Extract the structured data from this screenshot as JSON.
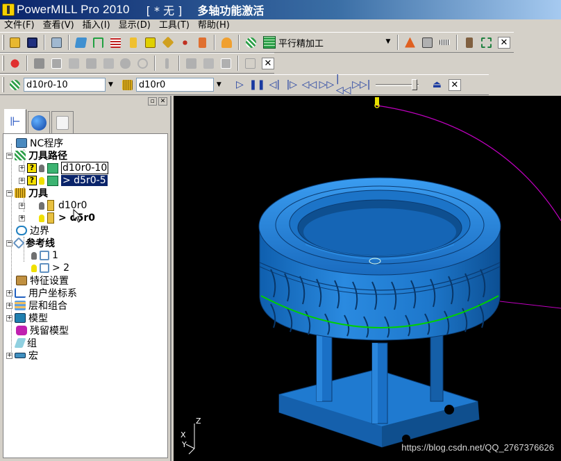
{
  "window": {
    "app_title": "PowerMILL Pro 2010",
    "project": "[ * 无 ]",
    "name": "多轴功能激活"
  },
  "menu": [
    "文件(F)",
    "查看(V)",
    "插入(I)",
    "显示(D)",
    "工具(T)",
    "帮助(H)"
  ],
  "toolbar_main": {
    "strategy_combo": "平行精加工"
  },
  "toolbar_selectors": {
    "toolpath_combo": "d10r0-10",
    "tool_combo": "d10r0"
  },
  "explorer": {
    "items": {
      "nc_programs": "NC程序",
      "toolpaths": "刀具路径",
      "toolpath_1": "d10r0-10",
      "toolpath_2": "> d5r0-5",
      "tools": "刀具",
      "tool_1": "d10r0",
      "tool_2": "> d5r0",
      "boundaries": "边界",
      "patterns": "参考线",
      "pattern_1": "1",
      "pattern_2": "> 2",
      "feature_sets": "特征设置",
      "workplanes": "用户坐标系",
      "levels": "层和组合",
      "models": "模型",
      "stock_models": "残留模型",
      "groups": "组",
      "macros": "宏"
    }
  },
  "viewport": {
    "watermark": "https://blog.csdn.net/QQ_2767376626",
    "axis_z": "Z",
    "axis_x": "X",
    "axis_y": "Y"
  },
  "colors": {
    "model": "#1e7ad4",
    "background": "#000000",
    "path_arc": "#c000c0",
    "path_green": "#00d000"
  }
}
